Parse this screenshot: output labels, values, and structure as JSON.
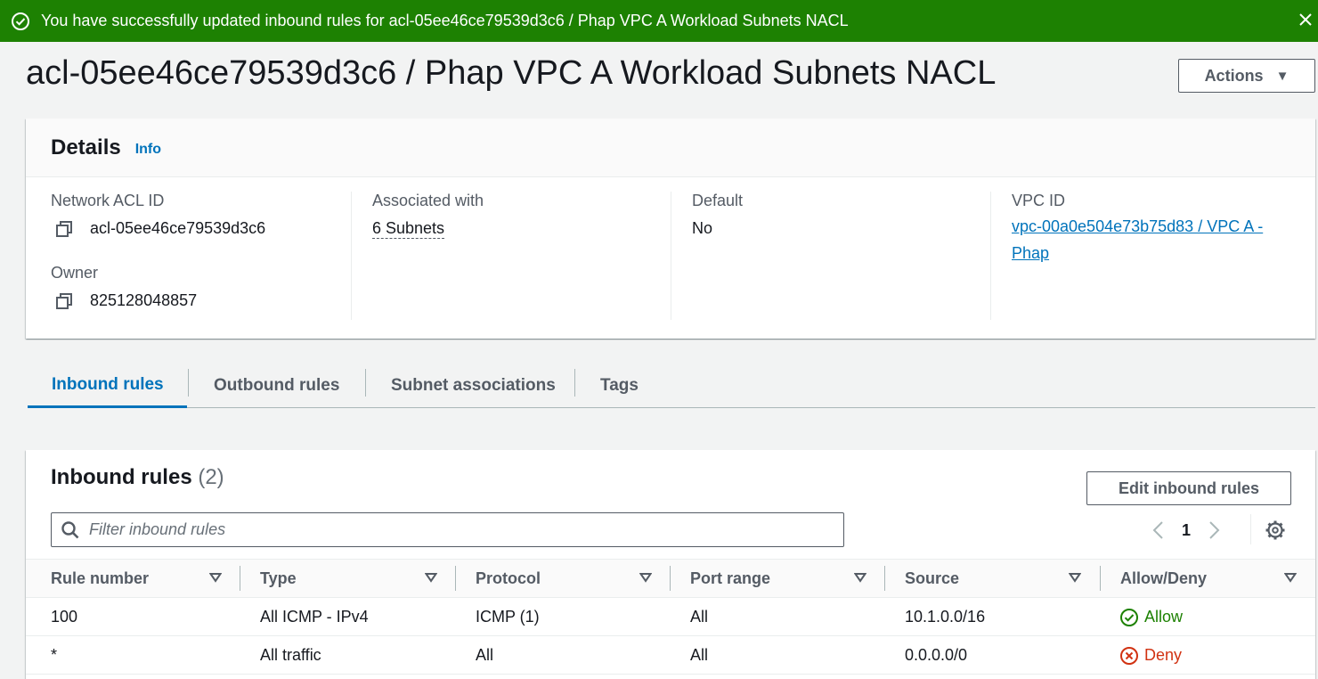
{
  "flash": {
    "message": "You have successfully updated inbound rules for acl-05ee46ce79539d3c6 / Phap VPC A Workload Subnets NACL",
    "color": "#1d8102"
  },
  "page": {
    "title": "acl-05ee46ce79539d3c6 / Phap VPC A Workload Subnets NACL",
    "actions_label": "Actions"
  },
  "details": {
    "title": "Details",
    "info_label": "Info",
    "network_acl_id_label": "Network ACL ID",
    "network_acl_id": "acl-05ee46ce79539d3c6",
    "owner_label": "Owner",
    "owner": "825128048857",
    "associated_label": "Associated with",
    "associated": "6 Subnets",
    "default_label": "Default",
    "default": "No",
    "vpc_id_label": "VPC ID",
    "vpc_id_line1": "vpc-00a0e504e73b75d83 / VPC A -",
    "vpc_id_line2": "Phap"
  },
  "tabs": [
    {
      "label": "Inbound rules",
      "active": true
    },
    {
      "label": "Outbound rules",
      "active": false
    },
    {
      "label": "Subnet associations",
      "active": false
    },
    {
      "label": "Tags",
      "active": false
    }
  ],
  "rules": {
    "title": "Inbound rules",
    "count": "(2)",
    "edit_label": "Edit inbound rules",
    "filter_placeholder": "Filter inbound rules",
    "page": "1",
    "columns": [
      "Rule number",
      "Type",
      "Protocol",
      "Port range",
      "Source",
      "Allow/Deny"
    ],
    "rows": [
      {
        "rule": "100",
        "type": "All ICMP - IPv4",
        "protocol": "ICMP (1)",
        "port": "All",
        "source": "10.1.0.0/16",
        "action": "Allow"
      },
      {
        "rule": "*",
        "type": "All traffic",
        "protocol": "All",
        "port": "All",
        "source": "0.0.0.0/0",
        "action": "Deny"
      }
    ]
  },
  "colors": {
    "link": "#0073bb",
    "allow": "#1d8102",
    "deny": "#d13212"
  }
}
